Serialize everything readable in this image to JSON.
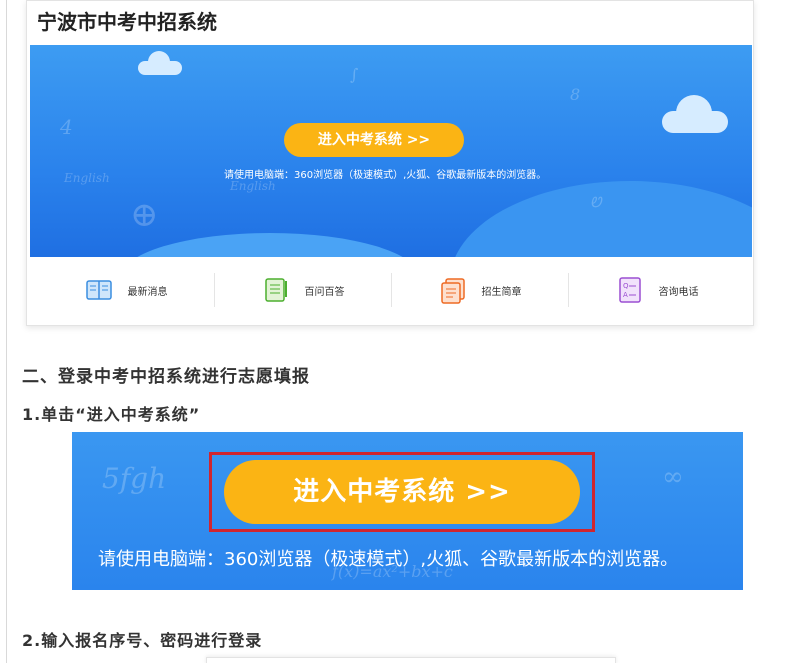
{
  "screenshot1": {
    "site_title": "宁波市中考中招系统",
    "enter_button": "进入中考系统 >>",
    "browser_tip": "请使用电脑端：360浏览器（极速模式）,火狐、谷歌最新版本的浏览器。",
    "nav_items": [
      {
        "label": "最新消息",
        "icon": "book-icon"
      },
      {
        "label": "百问百答",
        "icon": "notepad-icon"
      },
      {
        "label": "招生简章",
        "icon": "brochure-icon"
      },
      {
        "label": "咨询电话",
        "icon": "qa-icon"
      }
    ]
  },
  "article": {
    "section_heading": "二、登录中考中招系统进行志愿填报",
    "step1": "1.单击“进入中考系统”",
    "step2": "2.输入报名序号、密码进行登录"
  },
  "screenshot2": {
    "enter_button": "进入中考系统 >>",
    "browser_tip": "请使用电脑端：360浏览器（极速模式）,火狐、谷歌最新版本的浏览器。"
  },
  "colors": {
    "banner_blue": "#2a84ed",
    "button_yellow": "#fbb414",
    "highlight_red": "#d0252f"
  }
}
